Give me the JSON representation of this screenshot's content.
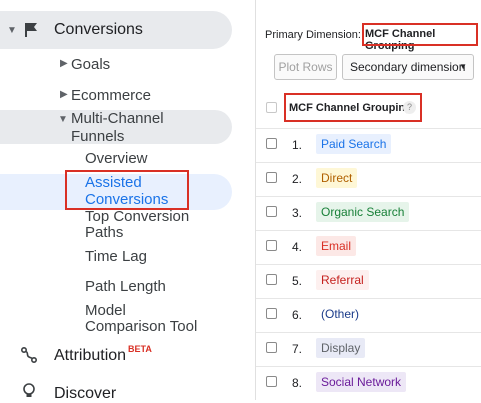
{
  "sidebar": {
    "conversions": {
      "label": "Conversions",
      "icon": "flag-icon"
    },
    "goals": "Goals",
    "ecommerce": "Ecommerce",
    "mcf": {
      "line1": "Multi-Channel",
      "line2": "Funnels"
    },
    "overview": "Overview",
    "assisted": {
      "line1": "Assisted",
      "line2": "Conversions"
    },
    "top_paths": {
      "line1": "Top Conversion",
      "line2": "Paths"
    },
    "time_lag": "Time Lag",
    "path_length": "Path Length",
    "model": {
      "line1": "Model",
      "line2": "Comparison Tool"
    },
    "attribution": {
      "label": "Attribution",
      "badge": "BETA",
      "icon": "attribution-icon"
    },
    "discover": {
      "label": "Discover",
      "icon": "lightbulb-icon"
    }
  },
  "panel": {
    "primary_dimension_label": "Primary Dimension:",
    "primary_dimension_value": "MCF Channel Grouping",
    "plot_rows": "Plot Rows",
    "secondary_dimension": "Secondary dimension",
    "column_header": "MCF Channel Grouping",
    "help_glyph": "?",
    "rows": [
      {
        "num": "1.",
        "label": "Paid Search",
        "color": "#1a73e8",
        "bg": "#e8f0fe"
      },
      {
        "num": "2.",
        "label": "Direct",
        "color": "#b06000",
        "bg": "#fef7d6"
      },
      {
        "num": "3.",
        "label": "Organic Search",
        "color": "#188038",
        "bg": "#e6f4ea"
      },
      {
        "num": "4.",
        "label": "Email",
        "color": "#d93025",
        "bg": "#fce8e6"
      },
      {
        "num": "5.",
        "label": "Referral",
        "color": "#c5221f",
        "bg": "#fdf0ef"
      },
      {
        "num": "6.",
        "label": "(Other)",
        "color": "#1a3b8a",
        "bg": "#ffffff"
      },
      {
        "num": "7.",
        "label": "Display",
        "color": "#5f6368",
        "bg": "#e8eaf6"
      },
      {
        "num": "8.",
        "label": "Social Network",
        "color": "#6a1b9a",
        "bg": "#ede7f6"
      }
    ]
  },
  "colors": {
    "accent": "#1a73e8",
    "highlight": "#d93025"
  }
}
